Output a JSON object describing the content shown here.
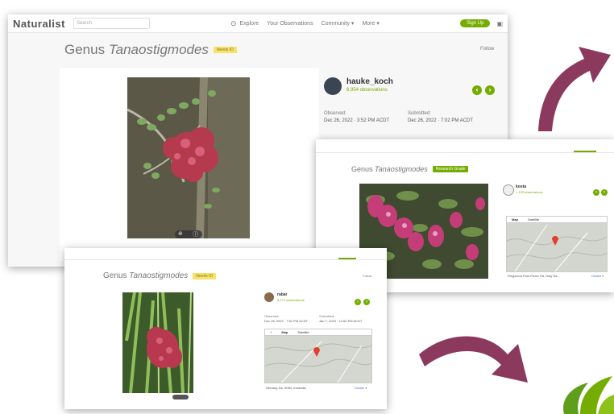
{
  "back": {
    "nav": {
      "logo": "Naturalist",
      "search_placeholder": "Search",
      "links": [
        "Explore",
        "Your Observations",
        "Community ▾",
        "More ▾"
      ],
      "signup": "Sign Up"
    },
    "title_prefix": "Genus ",
    "title_genus": "Tanaostigmodes",
    "badge": "Needs ID",
    "follow": "Follow",
    "user": "hauke_koch",
    "observations": "6,954 observations",
    "observed_label": "Observed:",
    "observed_value": "Dec 26, 2022 · 3:52 PM ACDT",
    "submitted_label": "Submitted:",
    "submitted_value": "Dec 26, 2022 · 7:02 PM ACDT"
  },
  "middle": {
    "title_prefix": "Genus ",
    "title_genus": "Tanaostigmodes",
    "badge": "Research Grade",
    "user": "kosta",
    "observations": "1,133 observations",
    "map_tab": "Map",
    "sat_tab": "Satellite",
    "location": "Ringwood Park Picnic Rd, Daly Sa...",
    "details": "Details ▾"
  },
  "front": {
    "title_prefix": "Genus ",
    "title_genus": "Tanaostigmodes",
    "badge": "Needs ID",
    "follow": "Follow",
    "user": "rabar",
    "observations": "8,170 observations",
    "observed_label": "Observed:",
    "observed_value": "Dec 26, 2022 · 7:51 PM ACDT",
    "submitted_label": "Submitted:",
    "submitted_value": "Jan 7, 2023 · 12:52 PM ACDT",
    "map_tab": "Map",
    "sat_tab": "Satellite",
    "location": "Nerrang SA, 5084, Australia",
    "details": "Details ▾"
  },
  "icons": {
    "prev": "‹",
    "next": "›",
    "lock": "🔒"
  },
  "colors": {
    "accent": "#74ac00",
    "arrow": "#8b3a5e",
    "badge_yellow": "#f7e26b",
    "marker": "#e0402a"
  }
}
